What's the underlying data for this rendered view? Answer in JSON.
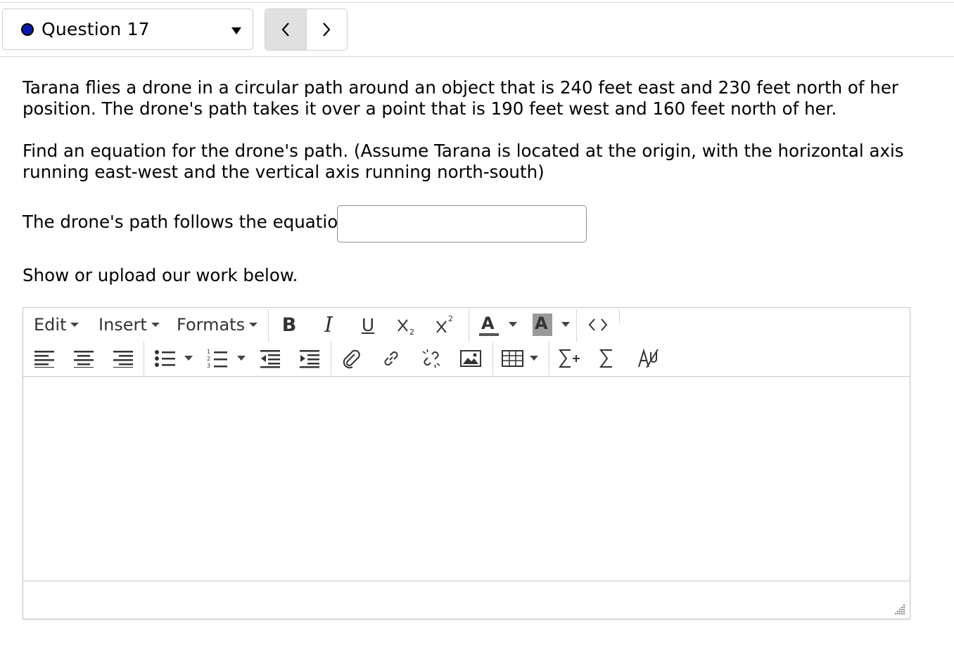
{
  "question_nav": {
    "label": "Question 17",
    "status_dot_color": "#0a1aa8"
  },
  "question": {
    "paragraph1": "Tarana flies a drone in a circular path around an object that is 240 feet east and 230 feet north of her position. The drone's path takes it over a point that is 190 feet west and 160 feet north of her.",
    "paragraph2": "Find an equation for the drone's path. (Assume Tarana is located at the origin, with the horizontal axis running east-west and the vertical axis running north-south)",
    "answer_prompt": "The drone's path follows the equation",
    "answer_value": "",
    "upload_prompt": "Show or upload our work below."
  },
  "editor": {
    "menus": {
      "edit": "Edit",
      "insert": "Insert",
      "formats": "Formats"
    },
    "icons": {
      "bold": "B",
      "italic": "I",
      "underline": "U",
      "text_color": "A",
      "highlight": "A"
    },
    "content": ""
  }
}
